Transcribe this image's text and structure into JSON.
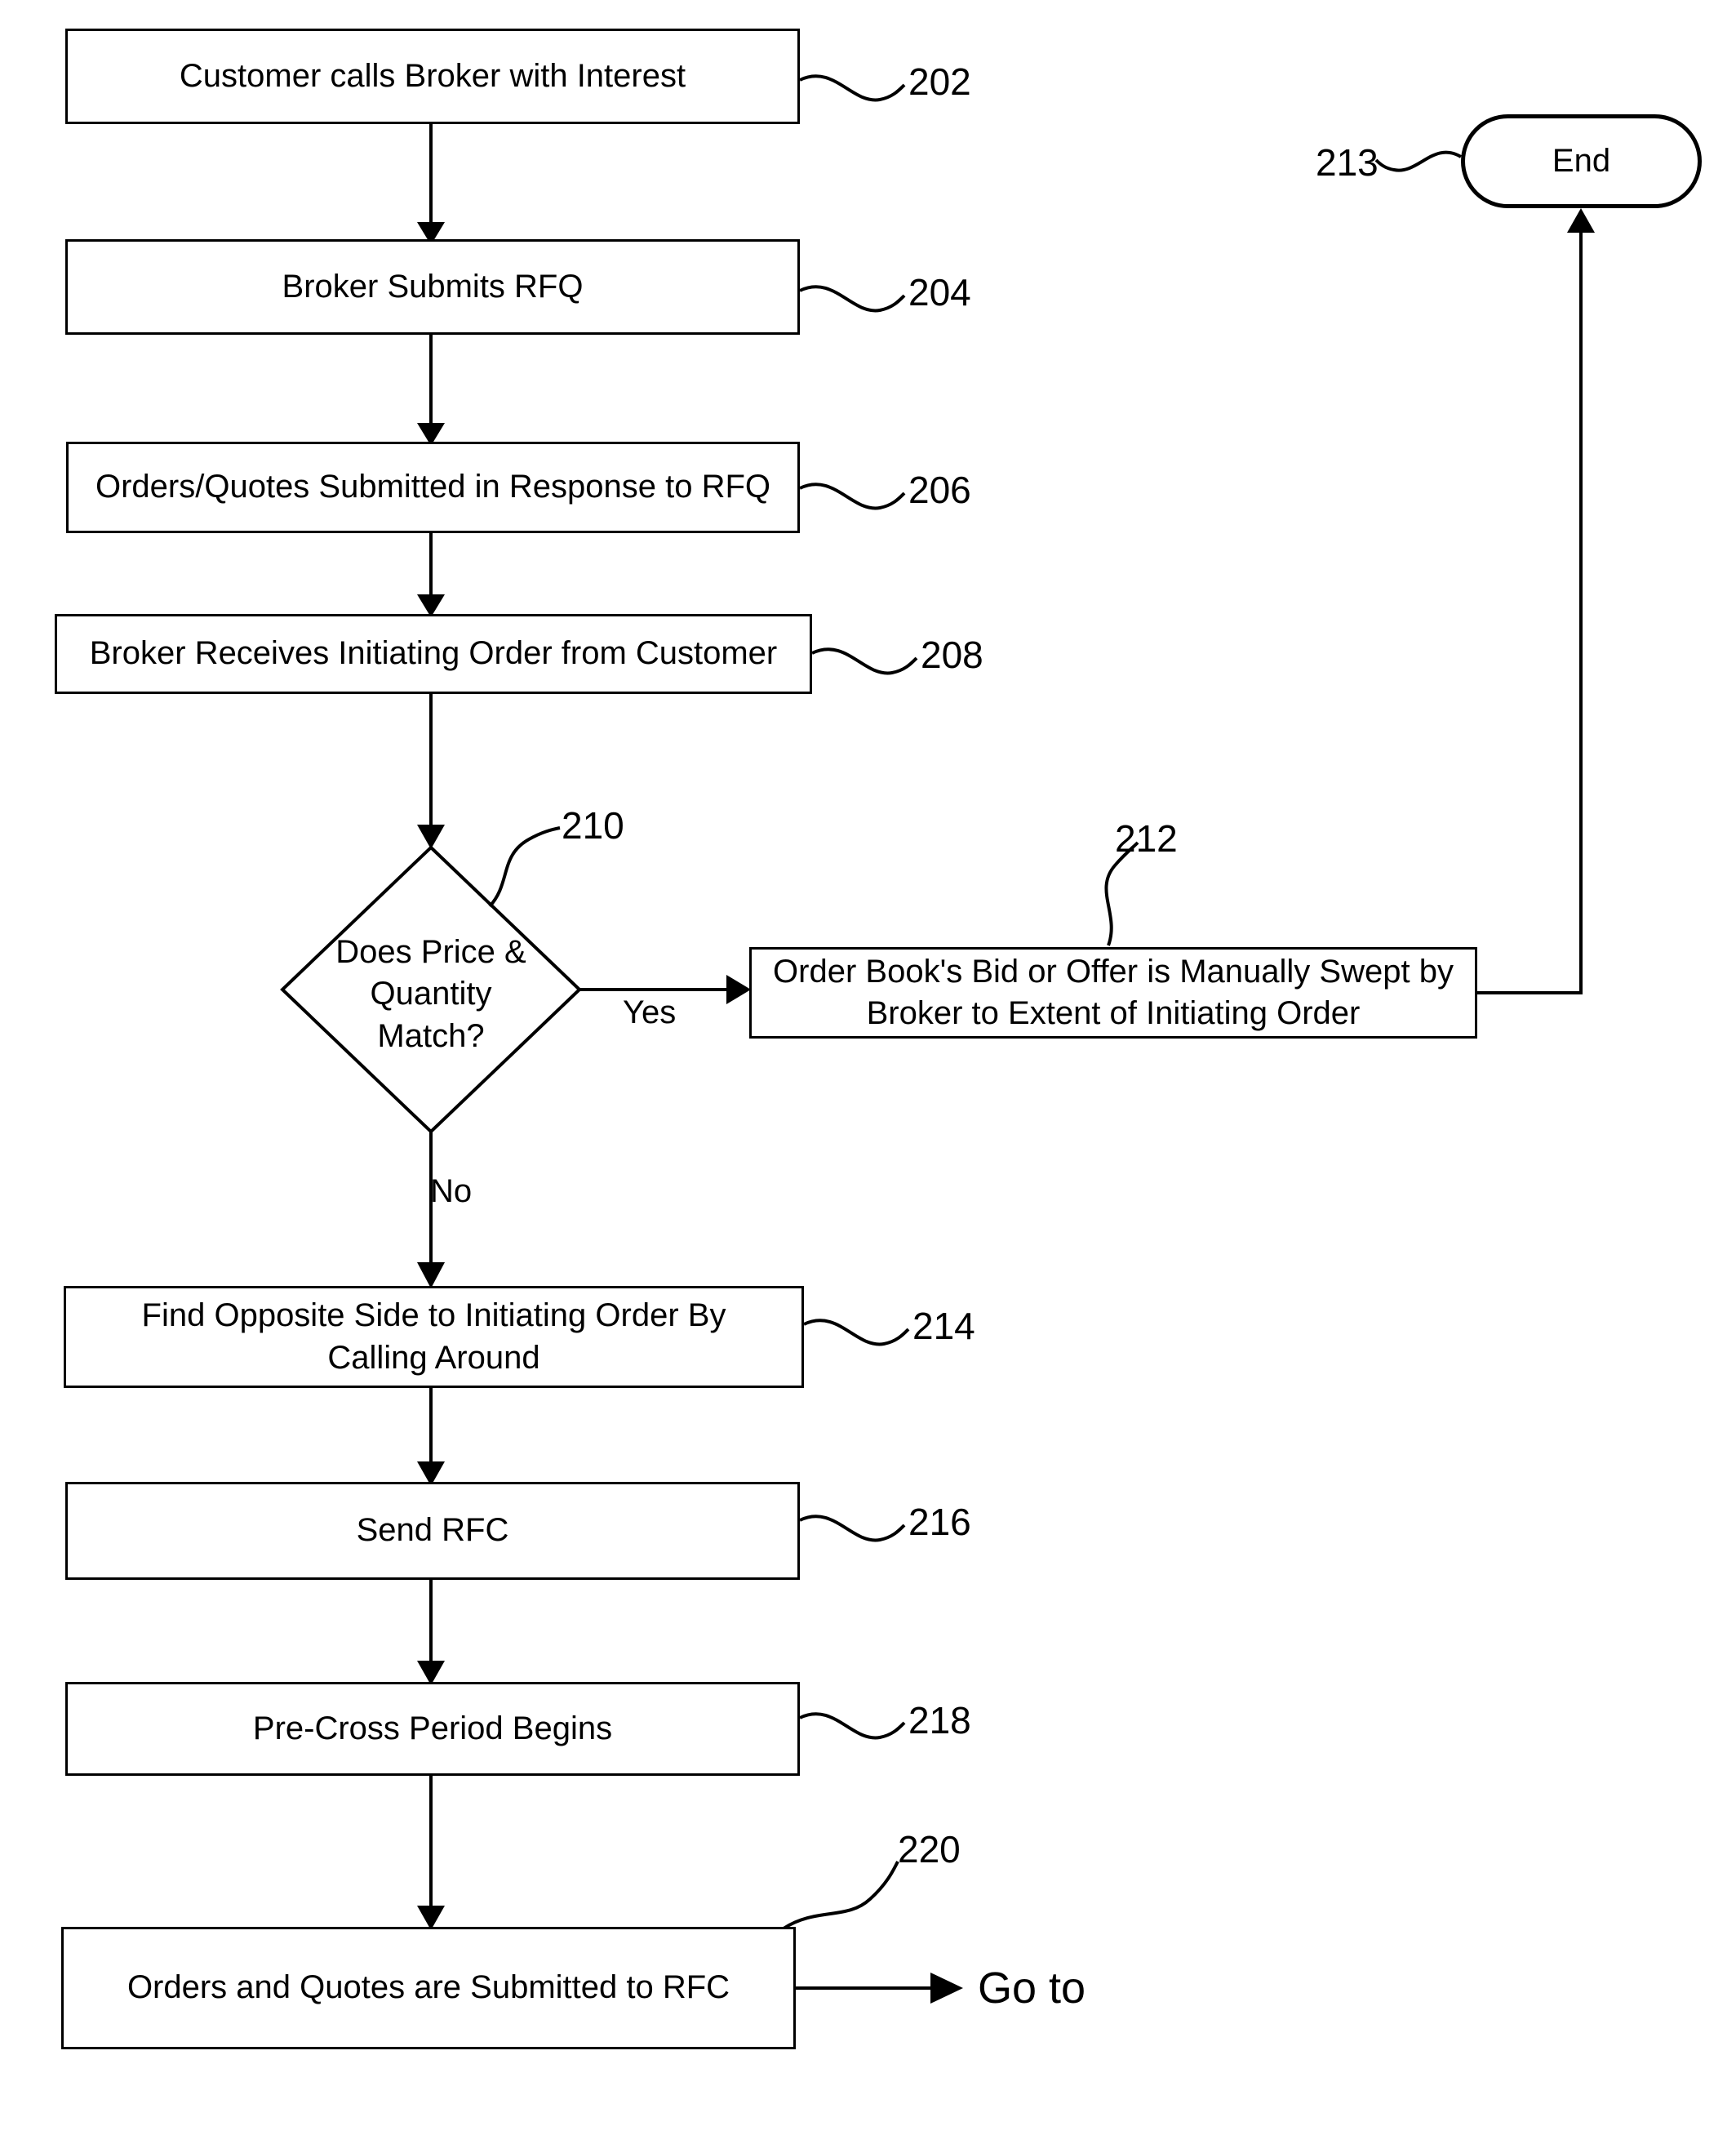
{
  "diagram": {
    "title": "Broker RFQ / RFC order handling flowchart",
    "stroke_color": "#000000",
    "background_color": "#ffffff",
    "nodes": [
      {
        "id": "202",
        "ref": "202",
        "shape": "process",
        "text": "Customer calls Broker with Interest"
      },
      {
        "id": "204",
        "ref": "204",
        "shape": "process",
        "text": "Broker Submits RFQ"
      },
      {
        "id": "206",
        "ref": "206",
        "shape": "process",
        "text": "Orders/Quotes Submitted in Response to RFQ"
      },
      {
        "id": "208",
        "ref": "208",
        "shape": "process",
        "text": "Broker Receives Initiating Order from Customer"
      },
      {
        "id": "210",
        "ref": "210",
        "shape": "decision",
        "text": "Does Price &\nQuantity\nMatch?"
      },
      {
        "id": "212",
        "ref": "212",
        "shape": "process",
        "text": "Order Book's Bid or Offer is Manually Swept by\nBroker to Extent of Initiating Order"
      },
      {
        "id": "213",
        "ref": "213",
        "shape": "terminal",
        "text": "End"
      },
      {
        "id": "214",
        "ref": "214",
        "shape": "process",
        "text": "Find Opposite Side to Initiating Order By\nCalling Around"
      },
      {
        "id": "216",
        "ref": "216",
        "shape": "process",
        "text": "Send RFC"
      },
      {
        "id": "218",
        "ref": "218",
        "shape": "process",
        "text": "Pre-Cross Period Begins"
      },
      {
        "id": "220",
        "ref": "220",
        "shape": "process",
        "text": "Orders and Quotes are Submitted to RFC"
      }
    ],
    "edge_labels": {
      "yes": "Yes",
      "no": "No"
    },
    "exit_label": "Go to"
  }
}
